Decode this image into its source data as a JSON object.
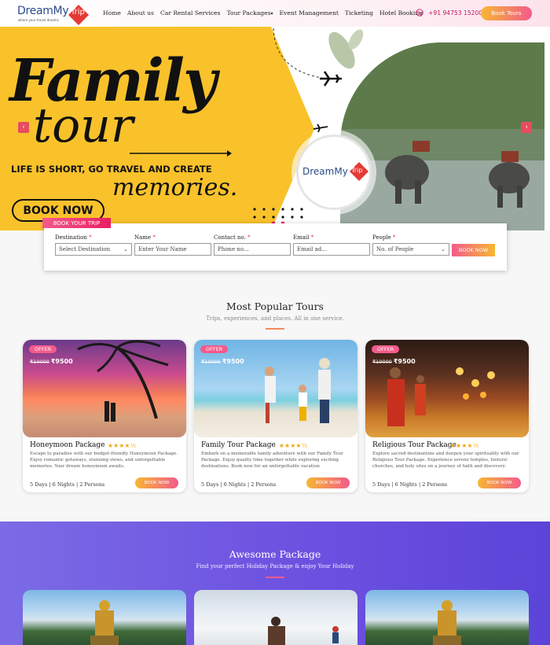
{
  "header": {
    "logo_text": "DreamMy",
    "logo_trip": "Trip",
    "logo_tagline": "where your travel dreams",
    "nav": [
      "Home",
      "About us",
      "Car Rental Services",
      "Tour Packages",
      "Event Management",
      "Ticketing",
      "Hotel Booking"
    ],
    "phone": "+91 94753 15200",
    "cta": "Book Tours"
  },
  "hero": {
    "title_line1": "Family",
    "title_line2": "tour",
    "tagline": "LIFE IS SHORT, GO TRAVEL AND CREATE",
    "tagline2": "memories.",
    "button": "BOOK NOW",
    "badge_logo_text": "DreamMy",
    "badge_logo_trip": "Trip",
    "colors": {
      "background": "#f9c22b",
      "accent": "#e74c5f"
    }
  },
  "booking_form": {
    "badge": "BOOK YOUR TRIP",
    "fields": [
      {
        "label": "Destination",
        "value": "Select Destination",
        "type": "select"
      },
      {
        "label": "Name",
        "value": "Enter Your Name",
        "type": "input"
      },
      {
        "label": "Contact no.",
        "value": "Phone no...",
        "type": "input"
      },
      {
        "label": "Email",
        "value": "Email ad...",
        "type": "input"
      },
      {
        "label": "People",
        "value": "No. of People",
        "type": "select"
      }
    ],
    "submit": "BOOK NOW"
  },
  "popular": {
    "title": "Most Popular Tours",
    "subtitle": "Trips, experiences, and places. All in one service.",
    "cards": [
      {
        "offer": "OFFER",
        "old_price": "₹10000",
        "price": "₹9500",
        "name": "Honeymoon Package",
        "stars": "★★★★½",
        "desc": "Escape to paradise with our budget-friendly Honeymoon Package. Enjoy romantic getaways, stunning views, and unforgettable memories. Your dream honeymoon awaits.",
        "meta": "5 Days | 6 Nights | 2 Persons",
        "button": "BOOK NOW"
      },
      {
        "offer": "OFFER",
        "old_price": "₹10000",
        "price": "₹9500",
        "name": "Family Tour Package",
        "stars": "★★★★½",
        "desc": "Embark on a memorable family adventure with our Family Tour Package. Enjoy quality time together while exploring exciting destinations. Book now for an unforgettable vacation",
        "meta": "5 Days | 6 Nights | 2 Persons",
        "button": "BOOK NOW"
      },
      {
        "offer": "OFFER",
        "old_price": "₹10000",
        "price": "₹9500",
        "name": "Religious Tour Package",
        "stars": "★★★★½",
        "desc": "Explore sacred destinations and deepen your spirituality with our Religious Tour Package. Experience serene temples, historic churches, and holy sites on a journey of faith and discovery.",
        "meta": "5 Days | 6 Nights | 2 Persons",
        "button": "BOOK NOW"
      }
    ]
  },
  "awesome": {
    "title": "Awesome Package",
    "subtitle": "Find your perfect Holiday Package & enjoy Your Holiday"
  }
}
